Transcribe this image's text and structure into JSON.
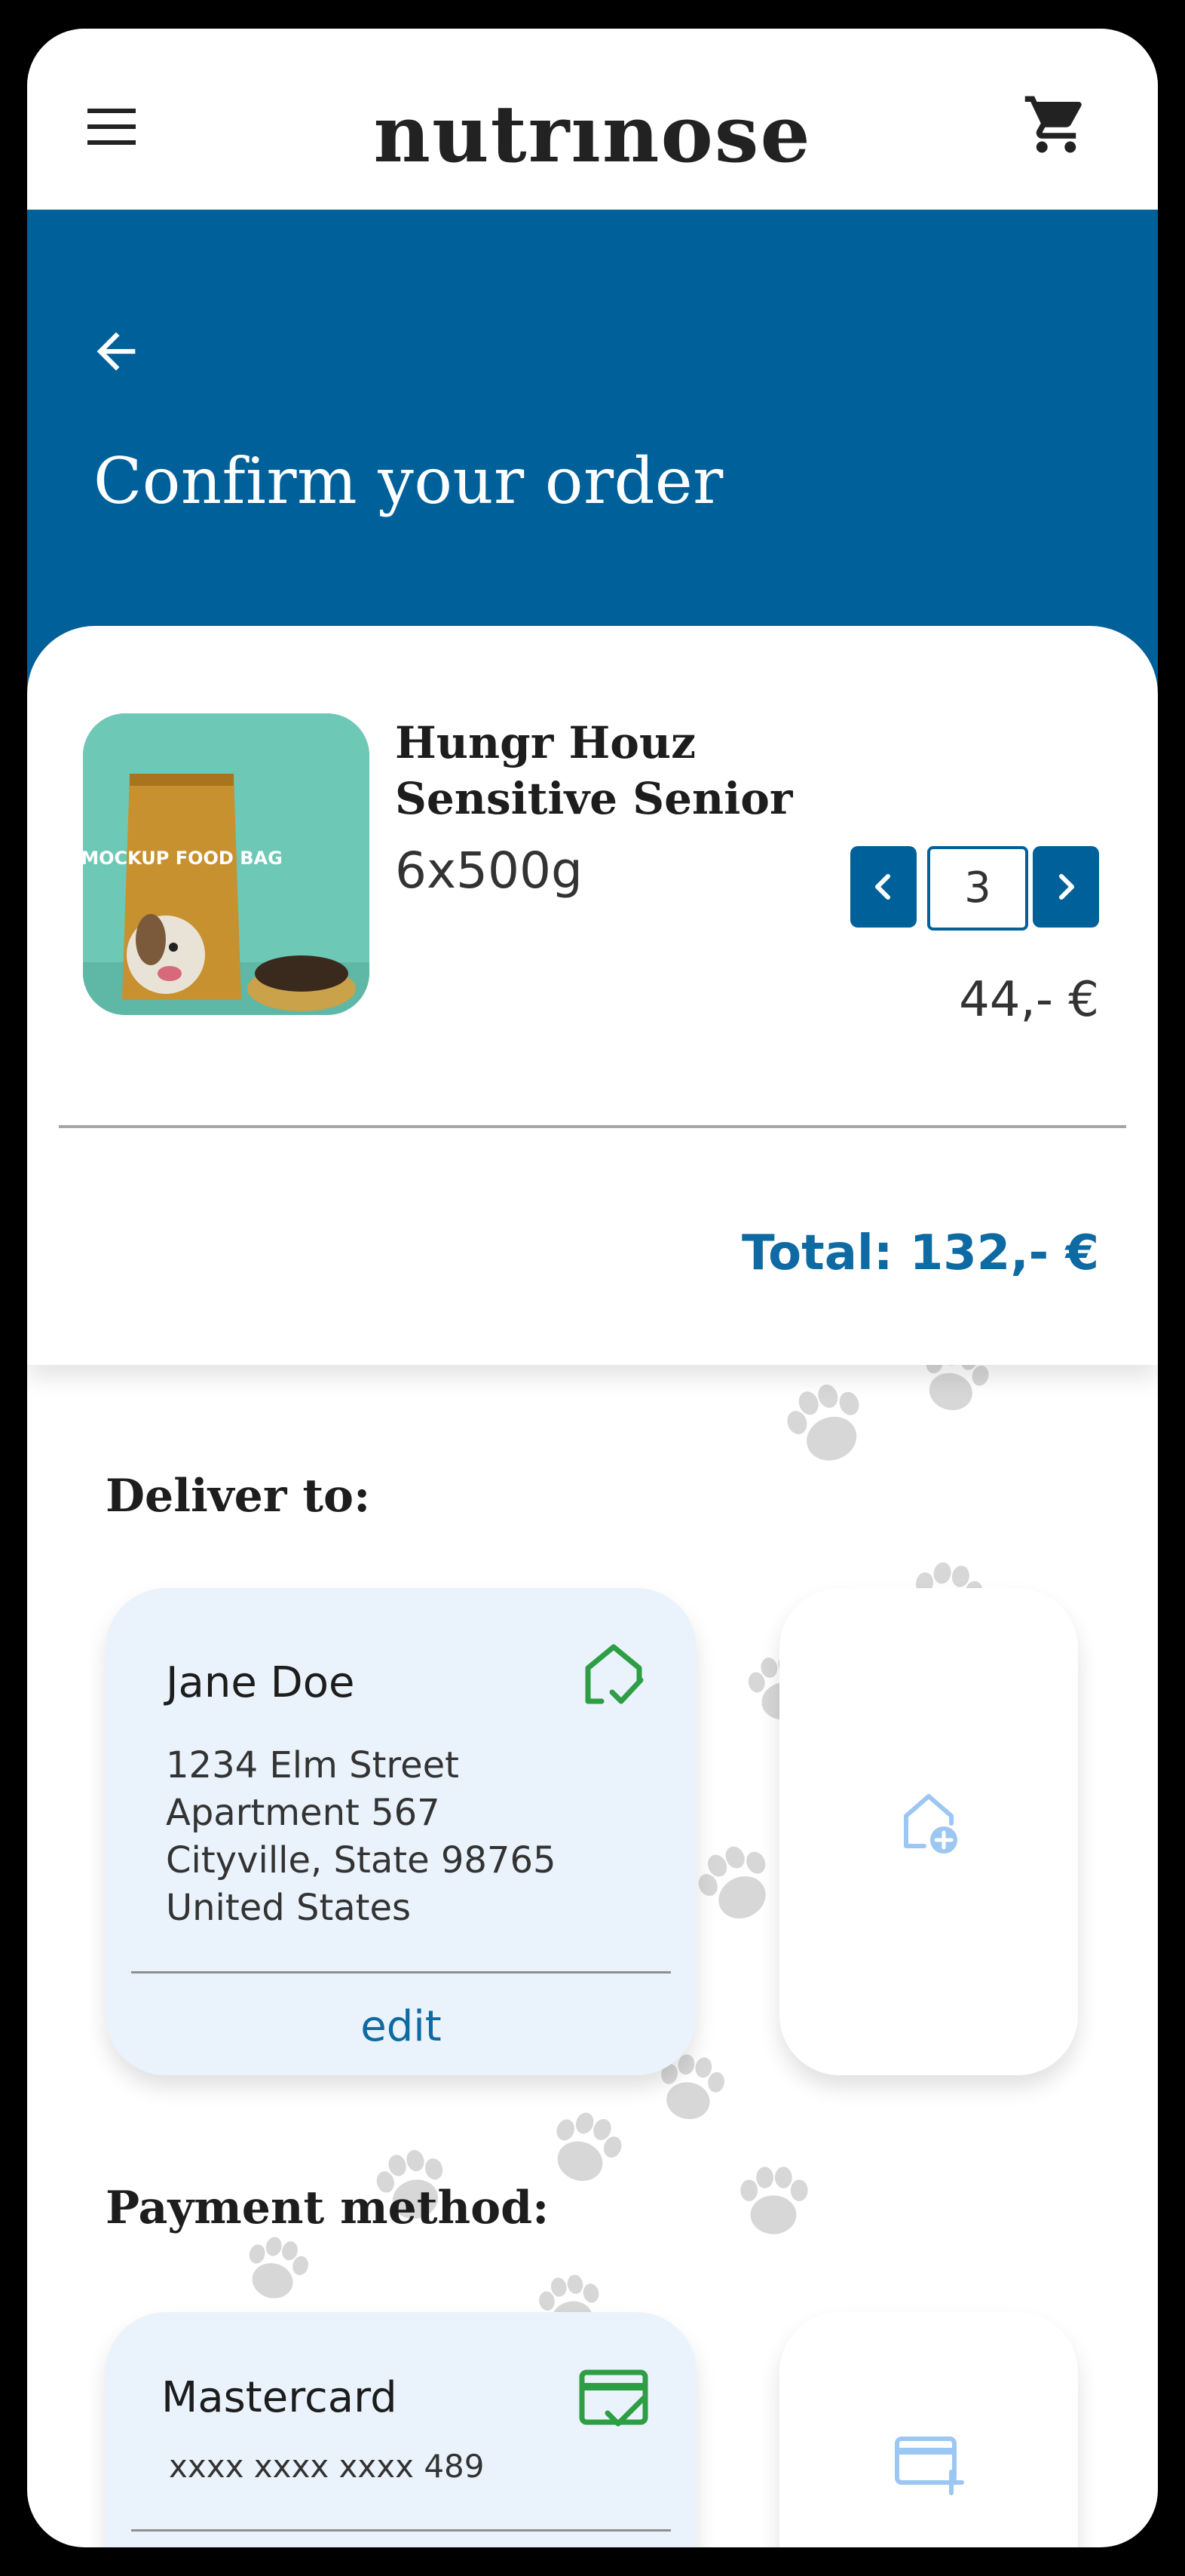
{
  "app": {
    "logo_text": "nutrınose",
    "brand_color": "#00619a",
    "accent_text_color": "#0d6aa3",
    "success_color": "#2e9e44",
    "icons": {
      "menu": "hamburger-menu-icon",
      "cart": "shopping-cart-icon",
      "back": "arrow-left-icon"
    }
  },
  "hero": {
    "title": "Confirm your order"
  },
  "order": {
    "item": {
      "image_label": "MOCKUP FOOD BAG",
      "name": "Hungr Houz Sensitive Senior",
      "size": "6x500g",
      "quantity": "3",
      "price": "44,- €"
    },
    "total": "Total: 132,- €"
  },
  "delivery": {
    "title": "Deliver to:",
    "address": {
      "name": "Jane Doe",
      "lines": [
        "1234 Elm Street",
        "Apartment 567",
        "Cityville, State 98765",
        "United States"
      ],
      "edit_label": "edit",
      "selected_icon": "home-check-icon"
    },
    "add_icon": "home-add-icon"
  },
  "payment": {
    "title": "Payment method:",
    "method": {
      "name": "Mastercard",
      "number": "xxxx xxxx xxxx 489",
      "selected_icon": "card-check-icon"
    },
    "add_icon": "card-add-icon"
  }
}
